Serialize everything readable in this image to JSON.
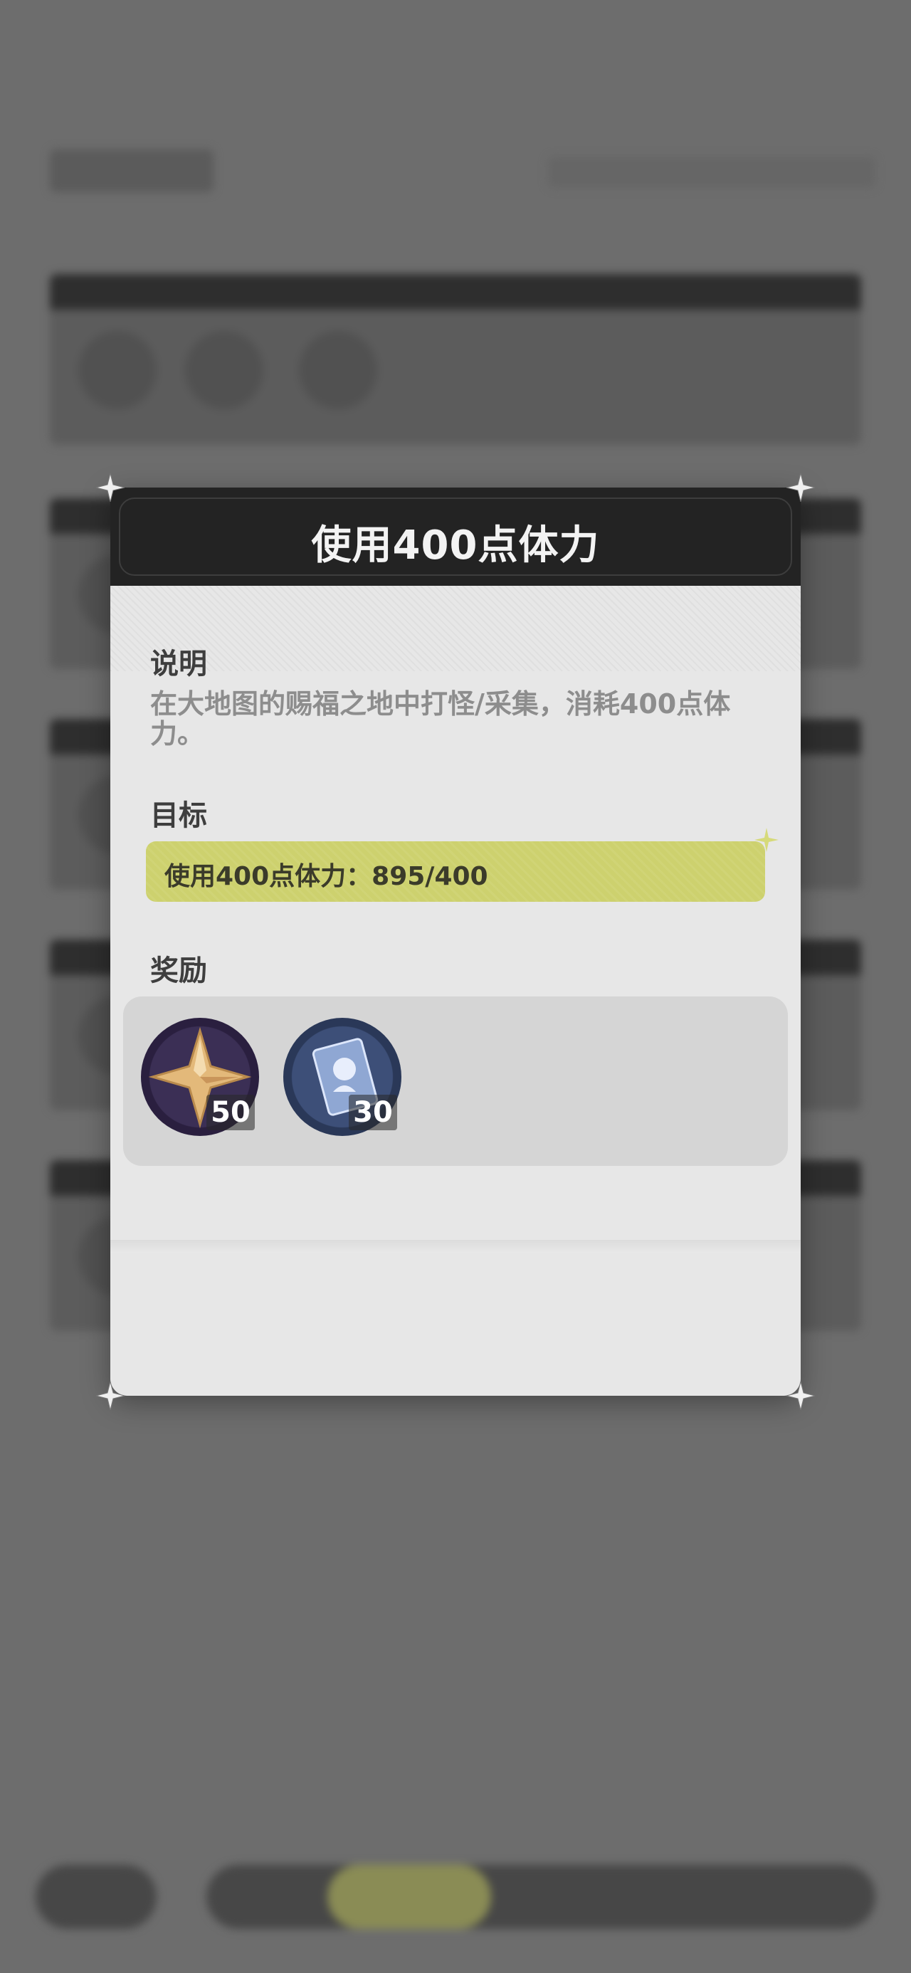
{
  "dialog": {
    "title": "使用400点体力",
    "description_heading": "说明",
    "description_text": "在大地图的赐福之地中打怪/采集，消耗400点体力。",
    "goal_heading": "目标",
    "goal_text": "使用400点体力：895/400",
    "rewards_heading": "奖励",
    "rewards": [
      {
        "icon": "primogem-star-icon",
        "quantity": "50",
        "ring_color": "#8a52d6"
      },
      {
        "icon": "character-card-icon",
        "quantity": "30",
        "ring_color": "#3f7fdc"
      }
    ]
  },
  "colors": {
    "header_bg": "#232323",
    "panel_bg": "#e7e7e7",
    "goal_bar": "#cdd16e",
    "overlay": "#6d6d6d"
  }
}
